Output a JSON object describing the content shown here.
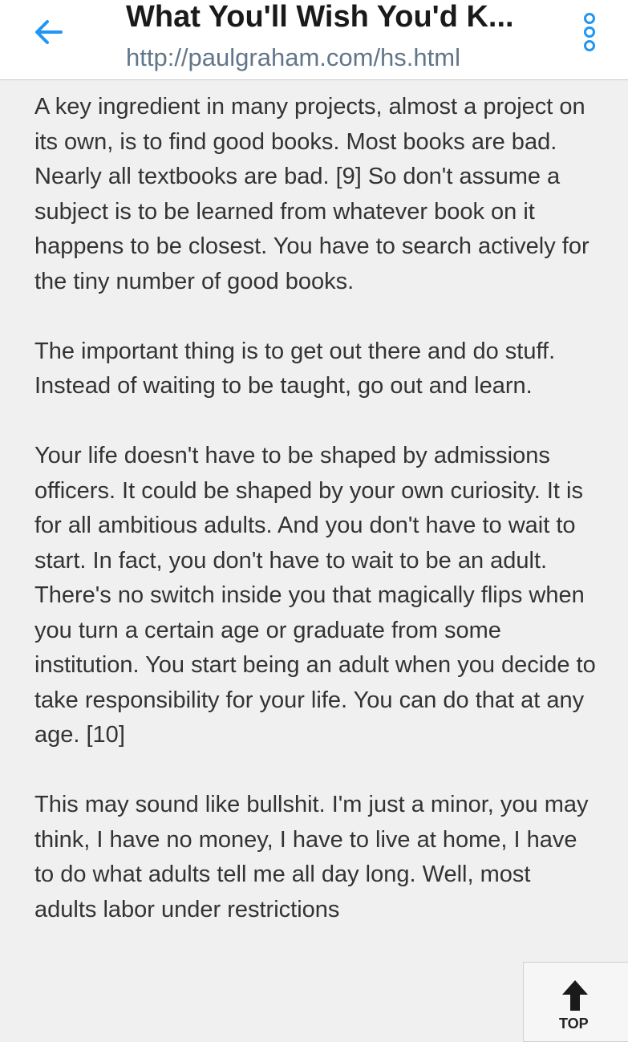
{
  "header": {
    "title": "What You'll Wish You'd K...",
    "url": "http://paulgraham.com/hs.html",
    "back_icon": "arrow-left-icon",
    "menu_icon": "more-vertical-icon",
    "accent_color": "#2196f3"
  },
  "article": {
    "paragraphs": [
      "A key ingredient in many projects, almost a project on its own, is to find good books. Most books are bad. Nearly all textbooks are bad. [9] So don't assume a subject is to be learned from whatever book on it happens to be closest. You have to search actively for the tiny number of good books.",
      "The important thing is to get out there and do stuff. Instead of waiting to be taught, go out and learn.",
      "Your life doesn't have to be shaped by admissions officers. It could be shaped by your own curiosity. It is for all ambitious adults. And you don't have to wait to start. In fact, you don't have to wait to be an adult. There's no switch inside you that magically flips when you turn a certain age or graduate from some institution. You start being an adult when you decide to take responsibility for your life. You can do that at any age. [10]",
      "This may sound like bullshit. I'm just a minor, you may think, I have no money, I have to live at home, I have to do what adults tell me all day long. Well, most adults labor under restrictions"
    ]
  },
  "scroll_top": {
    "label": "TOP",
    "icon": "arrow-up-icon"
  }
}
